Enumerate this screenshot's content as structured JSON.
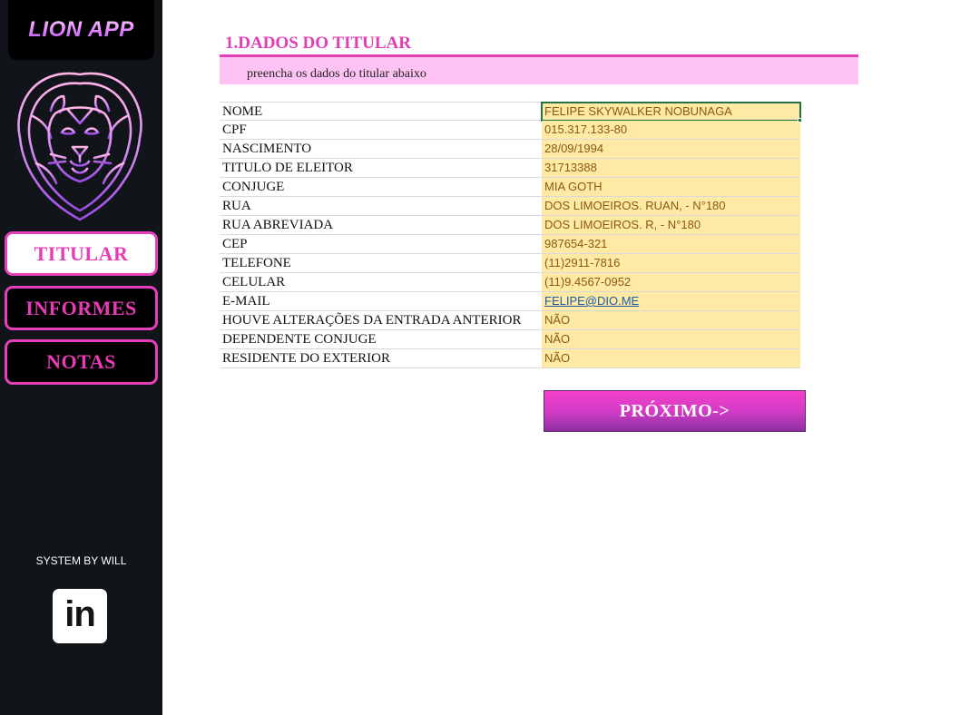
{
  "sidebar": {
    "logo": "LION APP",
    "nav": [
      {
        "label": "TITULAR",
        "active": true
      },
      {
        "label": "INFORMES",
        "active": false
      },
      {
        "label": "NOTAS",
        "active": false
      }
    ],
    "credit": "SYSTEM BY WILL",
    "social_icon": "linkedin-icon",
    "social_icon_text": "in"
  },
  "main": {
    "title": "1.DADOS DO TITULAR",
    "subtitle": "preencha os dados do titular abaixo",
    "fields": [
      {
        "label": "NOME",
        "value": "FELIPE SKYWALKER NOBUNAGA"
      },
      {
        "label": "CPF",
        "value": "015.317.133-80"
      },
      {
        "label": "NASCIMENTO",
        "value": "28/09/1994"
      },
      {
        "label": "TITULO DE ELEITOR",
        "value": "31713388"
      },
      {
        "label": "CONJUGE",
        "value": "MIA GOTH"
      },
      {
        "label": "RUA",
        "value": "DOS LIMOEIROS. RUAN, - N°180"
      },
      {
        "label": "RUA ABREVIADA",
        "value": "DOS LIMOEIROS. R, - N°180"
      },
      {
        "label": "CEP",
        "value": "987654-321"
      },
      {
        "label": "TELEFONE",
        "value": "(11)2911-7816"
      },
      {
        "label": "CELULAR",
        "value": "(11)9.4567-0952"
      },
      {
        "label": "E-MAIL",
        "value": "FELIPE@DIO.ME"
      },
      {
        "label": "HOUVE ALTERAÇÕES DA ENTRADA ANTERIOR",
        "value": "NÃO"
      },
      {
        "label": "DEPENDENTE CONJUGE",
        "value": "NÃO"
      },
      {
        "label": "RESIDENTE DO EXTERIOR",
        "value": "NÃO"
      }
    ],
    "next_button": "PRÓXIMO->"
  },
  "colors": {
    "accent": "#e23eb4",
    "sidebar_bg": "#111519",
    "value_fill": "#fee9a5",
    "subtitle_band": "#fec3f4"
  }
}
